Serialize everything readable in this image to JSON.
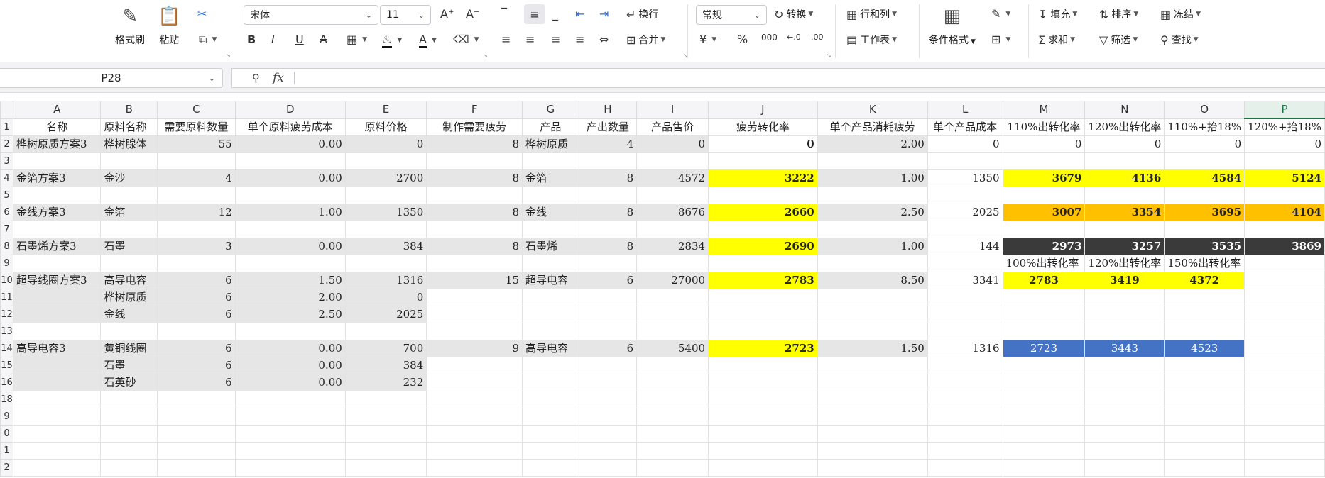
{
  "ribbon": {
    "format_painter": "格式刷",
    "paste": "粘贴",
    "font_name": "宋体",
    "font_size": "11",
    "wrap": "换行",
    "merge": "合并",
    "number_format": "常规",
    "convert": "转换",
    "rows_cols": "行和列",
    "worksheet": "工作表",
    "cond_format": "条件格式",
    "fill": "填充",
    "sort": "排序",
    "freeze": "冻结",
    "sum": "求和",
    "filter": "筛选",
    "find": "查找"
  },
  "formula_bar": {
    "cell_ref": "P28",
    "fx_label": "fx",
    "formula": ""
  },
  "columns": [
    "A",
    "B",
    "C",
    "D",
    "E",
    "F",
    "G",
    "H",
    "I",
    "J",
    "K",
    "L",
    "M",
    "N",
    "O",
    "P"
  ],
  "selected_column": "P",
  "rows": [
    {
      "n": "1",
      "cells": [
        {
          "v": "名称",
          "a": "c"
        },
        {
          "v": "原料名称",
          "a": "l"
        },
        {
          "v": "需要原料数量",
          "a": "c"
        },
        {
          "v": "单个原料疲劳成本",
          "a": "c"
        },
        {
          "v": "原料价格",
          "a": "c"
        },
        {
          "v": "制作需要疲劳",
          "a": "c"
        },
        {
          "v": "产品",
          "a": "c"
        },
        {
          "v": "产出数量",
          "a": "c"
        },
        {
          "v": "产品售价",
          "a": "c"
        },
        {
          "v": "疲劳转化率",
          "a": "c"
        },
        {
          "v": "单个产品消耗疲劳",
          "a": "c"
        },
        {
          "v": "单个产品成本",
          "a": "c"
        },
        {
          "v": "110%出转化率",
          "a": "c"
        },
        {
          "v": "120%出转化率",
          "a": "c"
        },
        {
          "v": "110%+抬18%",
          "a": "c"
        },
        {
          "v": "120%+抬18%",
          "a": "c"
        }
      ]
    },
    {
      "n": "2",
      "cells": [
        {
          "v": "桦树原质方案3",
          "a": "l",
          "s": "gray"
        },
        {
          "v": "桦树腺体",
          "a": "l",
          "s": "gray"
        },
        {
          "v": "55",
          "a": "r",
          "s": "gray"
        },
        {
          "v": "0.00",
          "a": "r",
          "s": "gray"
        },
        {
          "v": "0",
          "a": "r",
          "s": "gray"
        },
        {
          "v": "8",
          "a": "r",
          "s": "gray"
        },
        {
          "v": "桦树原质",
          "a": "l",
          "s": "gray"
        },
        {
          "v": "4",
          "a": "r",
          "s": "gray"
        },
        {
          "v": "0",
          "a": "r",
          "s": "gray"
        },
        {
          "v": "0",
          "a": "r",
          "s": "bold"
        },
        {
          "v": "2.00",
          "a": "r",
          "s": "gray"
        },
        {
          "v": "0",
          "a": "r"
        },
        {
          "v": "0",
          "a": "r"
        },
        {
          "v": "0",
          "a": "r"
        },
        {
          "v": "0",
          "a": "r"
        },
        {
          "v": "0",
          "a": "r"
        }
      ]
    },
    {
      "n": "3",
      "cells": [
        {},
        {},
        {},
        {},
        {},
        {},
        {},
        {},
        {},
        {},
        {},
        {},
        {},
        {},
        {},
        {}
      ]
    },
    {
      "n": "4",
      "cells": [
        {
          "v": "金箔方案3",
          "a": "l",
          "s": "gray"
        },
        {
          "v": "金沙",
          "a": "l",
          "s": "gray"
        },
        {
          "v": "4",
          "a": "r",
          "s": "gray"
        },
        {
          "v": "0.00",
          "a": "r",
          "s": "gray"
        },
        {
          "v": "2700",
          "a": "r",
          "s": "gray"
        },
        {
          "v": "8",
          "a": "r",
          "s": "gray"
        },
        {
          "v": "金箔",
          "a": "l",
          "s": "gray"
        },
        {
          "v": "8",
          "a": "r",
          "s": "gray"
        },
        {
          "v": "4572",
          "a": "r",
          "s": "gray"
        },
        {
          "v": "3222",
          "a": "r",
          "s": "yel"
        },
        {
          "v": "1.00",
          "a": "r",
          "s": "gray"
        },
        {
          "v": "1350",
          "a": "r"
        },
        {
          "v": "3679",
          "a": "r",
          "s": "yel"
        },
        {
          "v": "4136",
          "a": "r",
          "s": "yel"
        },
        {
          "v": "4584",
          "a": "r",
          "s": "yel"
        },
        {
          "v": "5124",
          "a": "r",
          "s": "yel"
        }
      ]
    },
    {
      "n": "5",
      "cells": [
        {},
        {},
        {},
        {},
        {},
        {},
        {},
        {},
        {},
        {},
        {},
        {},
        {},
        {},
        {},
        {}
      ]
    },
    {
      "n": "6",
      "cells": [
        {
          "v": "金线方案3",
          "a": "l",
          "s": "gray"
        },
        {
          "v": "金箔",
          "a": "l",
          "s": "gray"
        },
        {
          "v": "12",
          "a": "r",
          "s": "gray"
        },
        {
          "v": "1.00",
          "a": "r",
          "s": "gray"
        },
        {
          "v": "1350",
          "a": "r",
          "s": "gray"
        },
        {
          "v": "8",
          "a": "r",
          "s": "gray"
        },
        {
          "v": "金线",
          "a": "l",
          "s": "gray"
        },
        {
          "v": "8",
          "a": "r",
          "s": "gray"
        },
        {
          "v": "8676",
          "a": "r",
          "s": "gray"
        },
        {
          "v": "2660",
          "a": "r",
          "s": "yel"
        },
        {
          "v": "2.50",
          "a": "r",
          "s": "gray"
        },
        {
          "v": "2025",
          "a": "r"
        },
        {
          "v": "3007",
          "a": "r",
          "s": "ora"
        },
        {
          "v": "3354",
          "a": "r",
          "s": "ora"
        },
        {
          "v": "3695",
          "a": "r",
          "s": "ora"
        },
        {
          "v": "4104",
          "a": "r",
          "s": "ora"
        }
      ]
    },
    {
      "n": "7",
      "cells": [
        {},
        {},
        {},
        {},
        {},
        {},
        {},
        {},
        {},
        {},
        {},
        {},
        {},
        {},
        {},
        {}
      ]
    },
    {
      "n": "8",
      "cells": [
        {
          "v": "石墨烯方案3",
          "a": "l",
          "s": "gray"
        },
        {
          "v": "石墨",
          "a": "l",
          "s": "gray"
        },
        {
          "v": "3",
          "a": "r",
          "s": "gray"
        },
        {
          "v": "0.00",
          "a": "r",
          "s": "gray"
        },
        {
          "v": "384",
          "a": "r",
          "s": "gray"
        },
        {
          "v": "8",
          "a": "r",
          "s": "gray"
        },
        {
          "v": "石墨烯",
          "a": "l",
          "s": "gray"
        },
        {
          "v": "8",
          "a": "r",
          "s": "gray"
        },
        {
          "v": "2834",
          "a": "r",
          "s": "gray"
        },
        {
          "v": "2690",
          "a": "r",
          "s": "yel"
        },
        {
          "v": "1.00",
          "a": "r",
          "s": "gray"
        },
        {
          "v": "144",
          "a": "r"
        },
        {
          "v": "2973",
          "a": "r",
          "s": "blk"
        },
        {
          "v": "3257",
          "a": "r",
          "s": "blk"
        },
        {
          "v": "3535",
          "a": "r",
          "s": "blk"
        },
        {
          "v": "3869",
          "a": "r",
          "s": "blk"
        }
      ]
    },
    {
      "n": "9",
      "cells": [
        {},
        {},
        {},
        {},
        {},
        {},
        {},
        {},
        {},
        {},
        {},
        {},
        {
          "v": "100%出转化率",
          "a": "l"
        },
        {
          "v": "120%出转化率",
          "a": "l"
        },
        {
          "v": "150%出转化率",
          "a": "l"
        },
        {}
      ]
    },
    {
      "n": "10",
      "cells": [
        {
          "v": "超导线圈方案3",
          "a": "l",
          "s": "gray"
        },
        {
          "v": "高导电容",
          "a": "l",
          "s": "gray"
        },
        {
          "v": "6",
          "a": "r",
          "s": "gray"
        },
        {
          "v": "1.50",
          "a": "r",
          "s": "gray"
        },
        {
          "v": "1316",
          "a": "r",
          "s": "gray"
        },
        {
          "v": "15",
          "a": "r",
          "s": "gray"
        },
        {
          "v": "超导电容",
          "a": "l",
          "s": "gray"
        },
        {
          "v": "6",
          "a": "r",
          "s": "gray"
        },
        {
          "v": "27000",
          "a": "r",
          "s": "gray"
        },
        {
          "v": "2783",
          "a": "r",
          "s": "yel"
        },
        {
          "v": "8.50",
          "a": "r",
          "s": "gray"
        },
        {
          "v": "3341",
          "a": "r"
        },
        {
          "v": "2783",
          "a": "c",
          "s": "yel"
        },
        {
          "v": "3419",
          "a": "c",
          "s": "yel"
        },
        {
          "v": "4372",
          "a": "c",
          "s": "yel"
        },
        {}
      ]
    },
    {
      "n": "11",
      "cells": [
        {
          "s": "gray"
        },
        {
          "v": "桦树原质",
          "a": "l",
          "s": "gray"
        },
        {
          "v": "6",
          "a": "r",
          "s": "gray"
        },
        {
          "v": "2.00",
          "a": "r",
          "s": "gray"
        },
        {
          "v": "0",
          "a": "r",
          "s": "gray"
        },
        {},
        {},
        {},
        {},
        {},
        {},
        {},
        {},
        {},
        {},
        {}
      ]
    },
    {
      "n": "12",
      "cells": [
        {
          "s": "gray"
        },
        {
          "v": "金线",
          "a": "l",
          "s": "gray"
        },
        {
          "v": "6",
          "a": "r",
          "s": "gray"
        },
        {
          "v": "2.50",
          "a": "r",
          "s": "gray"
        },
        {
          "v": "2025",
          "a": "r",
          "s": "gray"
        },
        {},
        {},
        {},
        {},
        {},
        {},
        {},
        {},
        {},
        {},
        {}
      ]
    },
    {
      "n": "13",
      "cells": [
        {},
        {},
        {},
        {},
        {},
        {},
        {},
        {},
        {},
        {},
        {},
        {},
        {},
        {},
        {},
        {}
      ]
    },
    {
      "n": "14",
      "cells": [
        {
          "v": "高导电容3",
          "a": "l",
          "s": "gray"
        },
        {
          "v": "黄铜线圈",
          "a": "l",
          "s": "gray"
        },
        {
          "v": "6",
          "a": "r",
          "s": "gray"
        },
        {
          "v": "0.00",
          "a": "r",
          "s": "gray"
        },
        {
          "v": "700",
          "a": "r",
          "s": "gray"
        },
        {
          "v": "9",
          "a": "r",
          "s": "gray"
        },
        {
          "v": "高导电容",
          "a": "l",
          "s": "gray"
        },
        {
          "v": "6",
          "a": "r",
          "s": "gray"
        },
        {
          "v": "5400",
          "a": "r",
          "s": "gray"
        },
        {
          "v": "2723",
          "a": "r",
          "s": "yel"
        },
        {
          "v": "1.50",
          "a": "r",
          "s": "gray"
        },
        {
          "v": "1316",
          "a": "r"
        },
        {
          "v": "2723",
          "a": "c",
          "s": "blu"
        },
        {
          "v": "3443",
          "a": "c",
          "s": "blu"
        },
        {
          "v": "4523",
          "a": "c",
          "s": "blu"
        },
        {}
      ]
    },
    {
      "n": "15",
      "cells": [
        {
          "s": "gray"
        },
        {
          "v": "石墨",
          "a": "l",
          "s": "gray"
        },
        {
          "v": "6",
          "a": "r",
          "s": "gray"
        },
        {
          "v": "0.00",
          "a": "r",
          "s": "gray"
        },
        {
          "v": "384",
          "a": "r",
          "s": "gray"
        },
        {},
        {},
        {},
        {},
        {},
        {},
        {},
        {},
        {},
        {},
        {}
      ]
    },
    {
      "n": "16",
      "cells": [
        {
          "s": "gray"
        },
        {
          "v": "石英砂",
          "a": "l",
          "s": "gray"
        },
        {
          "v": "6",
          "a": "r",
          "s": "gray"
        },
        {
          "v": "0.00",
          "a": "r",
          "s": "gray"
        },
        {
          "v": "232",
          "a": "r",
          "s": "gray"
        },
        {},
        {},
        {},
        {},
        {},
        {},
        {},
        {},
        {},
        {},
        {}
      ]
    },
    {
      "n": "18",
      "cells": [
        {},
        {},
        {},
        {},
        {},
        {},
        {},
        {},
        {},
        {},
        {},
        {},
        {},
        {},
        {},
        {}
      ]
    },
    {
      "n": "9",
      "cells": [
        {},
        {},
        {},
        {},
        {},
        {},
        {},
        {},
        {},
        {},
        {},
        {},
        {},
        {},
        {},
        {}
      ]
    },
    {
      "n": "0",
      "cells": [
        {},
        {},
        {},
        {},
        {},
        {},
        {},
        {},
        {},
        {},
        {},
        {},
        {},
        {},
        {},
        {}
      ]
    },
    {
      "n": "1",
      "cells": [
        {},
        {},
        {},
        {},
        {},
        {},
        {},
        {},
        {},
        {},
        {},
        {},
        {},
        {},
        {},
        {}
      ]
    },
    {
      "n": "2",
      "cells": [
        {},
        {},
        {},
        {},
        {},
        {},
        {},
        {},
        {},
        {},
        {},
        {},
        {},
        {},
        {},
        {}
      ]
    }
  ]
}
